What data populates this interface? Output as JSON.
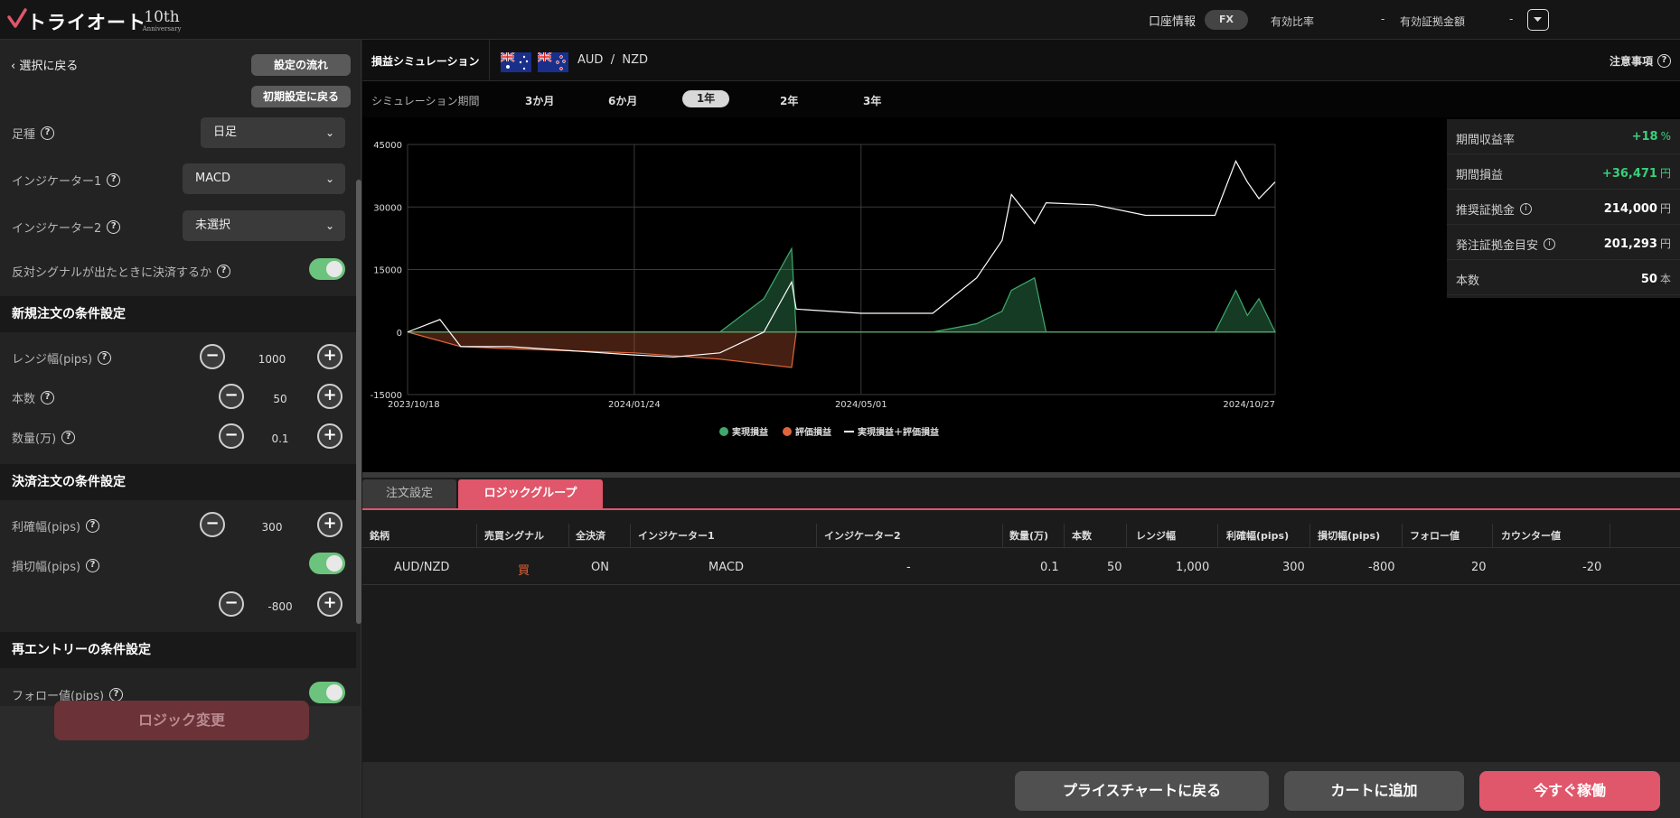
{
  "header": {
    "logo_text": "トライオート",
    "logo_badge": "10th",
    "logo_badge_sub": "Anniversary",
    "account_info": "口座情報",
    "fx": "FX",
    "effective_ratio_label": "有効比率",
    "effective_ratio_value": "-",
    "effective_margin_label": "有効証拠金額",
    "effective_margin_value": "-"
  },
  "left": {
    "back": "選択に戻る",
    "flow_button": "設定の流れ",
    "reset_button": "初期設定に戻る",
    "ashi_label": "足種",
    "ashi_value": "日足",
    "indicator1_label": "インジケーター1",
    "indicator1_value": "MACD",
    "indicator2_label": "インジケーター2",
    "indicator2_value": "未選択",
    "opposite_signal_label": "反対シグナルが出たときに決済するか",
    "new_order_section": "新規注文の条件設定",
    "range_label": "レンジ幅(pips)",
    "range_value": "1000",
    "count_label": "本数",
    "count_value": "50",
    "qty_label": "数量(万)",
    "qty_value": "0.1",
    "settle_section": "決済注文の条件設定",
    "profit_label": "利確幅(pips)",
    "profit_value": "300",
    "loss_label": "損切幅(pips)",
    "loss_value": "-800",
    "reentry_section": "再エントリーの条件設定",
    "follow_label": "フォロー値(pips)",
    "logic_change": "ロジック変更"
  },
  "sim": {
    "title": "損益シミュレーション",
    "base": "AUD",
    "slash": "/",
    "quote": "NZD",
    "notes": "注意事項",
    "period_label": "シミュレーション期間",
    "periods": [
      "3か月",
      "6か月",
      "1年",
      "2年",
      "3年"
    ],
    "active_period": "1年"
  },
  "stats": [
    {
      "label": "期間収益率",
      "value": "+18",
      "unit": "%"
    },
    {
      "label": "期間損益",
      "value": "+36,471",
      "unit": "円"
    },
    {
      "label": "推奨証拠金",
      "value": "214,000",
      "unit": "円"
    },
    {
      "label": "発注証拠金目安",
      "value": "201,293",
      "unit": "円"
    },
    {
      "label": "本数",
      "value": "50",
      "unit": "本"
    }
  ],
  "chart_data": {
    "type": "area",
    "x_ticks": [
      "2023/10/18",
      "2024/01/24",
      "2024/05/01",
      "2024/10/27"
    ],
    "y_ticks": [
      45000,
      30000,
      15000,
      0,
      -15000
    ],
    "ylim": [
      -15000,
      45000
    ],
    "legend": [
      "実現損益",
      "評価損益",
      "実現損益＋評価損益"
    ],
    "colors": {
      "realized": "#3fa96b",
      "unrealized": "#e0663a",
      "total": "#ffffff"
    },
    "series": [
      {
        "name": "実現損益",
        "x": [
          "2023/10/18",
          "2023/11/10",
          "2023/12/01",
          "2024/01/24",
          "2024/03/01",
          "2024/03/20",
          "2024/04/01",
          "2024/04/03",
          "2024/05/01",
          "2024/06/01",
          "2024/06/20",
          "2024/07/01",
          "2024/07/05",
          "2024/07/15",
          "2024/07/20",
          "2024/07/25",
          "2024/08/01",
          "2024/09/01",
          "2024/10/01",
          "2024/10/10",
          "2024/10/15",
          "2024/10/20",
          "2024/10/27"
        ],
        "values": [
          0,
          0,
          0,
          0,
          0,
          8000,
          20000,
          0,
          0,
          0,
          2000,
          5000,
          10000,
          13000,
          0,
          0,
          0,
          0,
          0,
          10000,
          4000,
          8000,
          0
        ]
      },
      {
        "name": "評価損益",
        "x": [
          "2023/10/18",
          "2023/11/10",
          "2023/12/01",
          "2024/01/24",
          "2024/03/01",
          "2024/04/01",
          "2024/04/03",
          "2024/10/27"
        ],
        "values": [
          0,
          -3500,
          -4000,
          -5000,
          -6500,
          -8500,
          0,
          0
        ]
      },
      {
        "name": "実現損益＋評価損益",
        "x": [
          "2023/10/18",
          "2023/11/01",
          "2023/11/10",
          "2023/12/01",
          "2024/01/24",
          "2024/02/10",
          "2024/03/01",
          "2024/03/20",
          "2024/04/01",
          "2024/04/03",
          "2024/05/01",
          "2024/06/01",
          "2024/06/20",
          "2024/07/01",
          "2024/07/05",
          "2024/07/15",
          "2024/07/20",
          "2024/08/10",
          "2024/09/01",
          "2024/10/01",
          "2024/10/10",
          "2024/10/15",
          "2024/10/20",
          "2024/10/27"
        ],
        "values": [
          0,
          3000,
          -3500,
          -3500,
          -5500,
          -6000,
          -5000,
          0,
          12000,
          5500,
          4500,
          4500,
          13000,
          22000,
          33000,
          26000,
          31000,
          30500,
          28000,
          28000,
          41000,
          36000,
          32000,
          36000
        ]
      }
    ]
  },
  "tabs": {
    "order": "注文設定",
    "logic": "ロジックグループ"
  },
  "table": {
    "headers": [
      "銘柄",
      "売買シグナル",
      "全決済",
      "インジケーター1",
      "インジケーター2",
      "数量(万)",
      "本数",
      "レンジ幅",
      "利確幅(pips)",
      "損切幅(pips)",
      "フォロー値",
      "カウンター値"
    ],
    "row": [
      "AUD/NZD",
      "買",
      "ON",
      "MACD",
      "-",
      "0.1",
      "50",
      "1,000",
      "300",
      "-800",
      "20",
      "-20"
    ]
  },
  "footer": {
    "back_to_chart": "プライスチャートに戻る",
    "add_cart": "カートに追加",
    "start_now": "今すぐ稼働"
  }
}
